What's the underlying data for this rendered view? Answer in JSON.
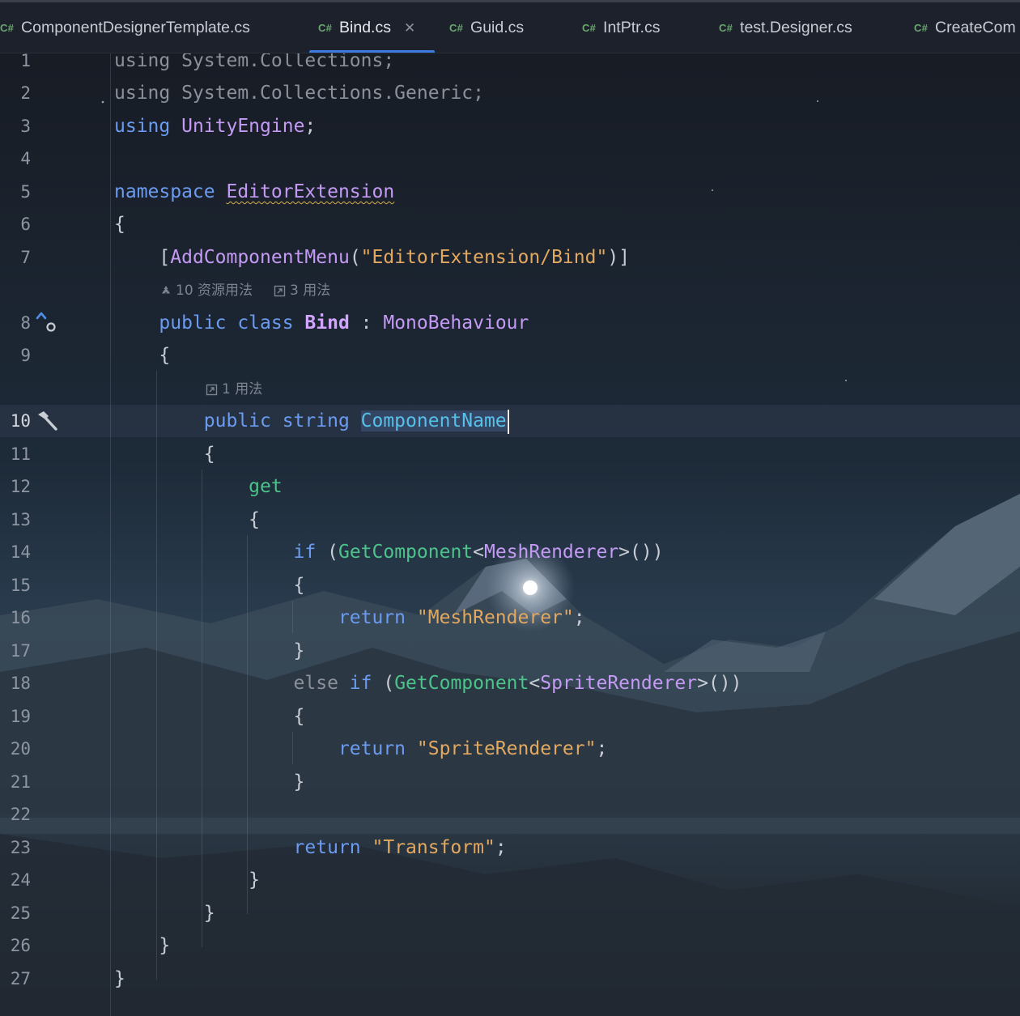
{
  "tabs": [
    {
      "lang": "C#",
      "label": "ComponentDesignerTemplate.cs"
    },
    {
      "lang": "C#",
      "label": "Bind.cs",
      "active": true
    },
    {
      "lang": "C#",
      "label": "Guid.cs"
    },
    {
      "lang": "C#",
      "label": "IntPtr.cs"
    },
    {
      "lang": "C#",
      "label": "test.Designer.cs"
    },
    {
      "lang": "C#",
      "label": "CreateCom"
    }
  ],
  "editor": {
    "hints": {
      "class_resource_usages": "10 资源用法",
      "class_usages": "3 用法",
      "property_usages": "1 用法"
    },
    "lines": [
      {
        "n": "1",
        "tokens": [
          [
            "dim",
            "using System.Collections;"
          ]
        ]
      },
      {
        "n": "2",
        "tokens": [
          [
            "dim",
            "using System.Collections.Generic;"
          ]
        ]
      },
      {
        "n": "3",
        "tokens": [
          [
            "kw",
            "using "
          ],
          [
            "ty",
            "UnityEngine"
          ],
          [
            "pl",
            ";"
          ]
        ]
      },
      {
        "n": "4",
        "tokens": []
      },
      {
        "n": "5",
        "tokens": [
          [
            "kw",
            "namespace "
          ],
          [
            "ty squig",
            "EditorExtension"
          ]
        ]
      },
      {
        "n": "6",
        "tokens": [
          [
            "pl",
            "{"
          ]
        ]
      },
      {
        "n": "7",
        "tokens": [
          [
            "pl",
            "    ["
          ],
          [
            "ty",
            "AddComponentMenu"
          ],
          [
            "pl",
            "("
          ],
          [
            "str",
            "\"EditorExtension/Bind\""
          ],
          [
            "pl",
            ")]"
          ]
        ]
      },
      {
        "n": "8",
        "tokens": [
          [
            "kw",
            "    public class "
          ],
          [
            "bold",
            "Bind"
          ],
          [
            "pl",
            " : "
          ],
          [
            "ty",
            "MonoBehaviour"
          ]
        ]
      },
      {
        "n": "9",
        "tokens": [
          [
            "pl",
            "    {"
          ]
        ]
      },
      {
        "n": "10",
        "tokens": [
          [
            "kw",
            "        public string "
          ],
          [
            "id sel",
            "ComponentName"
          ]
        ]
      },
      {
        "n": "11",
        "tokens": [
          [
            "pl",
            "        {"
          ]
        ]
      },
      {
        "n": "12",
        "tokens": [
          [
            "fn",
            "            get"
          ]
        ]
      },
      {
        "n": "13",
        "tokens": [
          [
            "pl",
            "            {"
          ]
        ]
      },
      {
        "n": "14",
        "tokens": [
          [
            "kw",
            "                if "
          ],
          [
            "pl",
            "("
          ],
          [
            "fn",
            "GetComponent"
          ],
          [
            "pl",
            "<"
          ],
          [
            "ty",
            "MeshRenderer"
          ],
          [
            "pl",
            ">())"
          ]
        ]
      },
      {
        "n": "15",
        "tokens": [
          [
            "pl",
            "                {"
          ]
        ]
      },
      {
        "n": "16",
        "tokens": [
          [
            "kw",
            "                    return "
          ],
          [
            "str",
            "\"MeshRenderer\""
          ],
          [
            "pl",
            ";"
          ]
        ]
      },
      {
        "n": "17",
        "tokens": [
          [
            "pl",
            "                }"
          ]
        ]
      },
      {
        "n": "18",
        "tokens": [
          [
            "dim",
            "                else "
          ],
          [
            "kw",
            "if "
          ],
          [
            "pl",
            "("
          ],
          [
            "fn",
            "GetComponent"
          ],
          [
            "pl",
            "<"
          ],
          [
            "ty",
            "SpriteRenderer"
          ],
          [
            "pl",
            ">())"
          ]
        ]
      },
      {
        "n": "19",
        "tokens": [
          [
            "pl",
            "                {"
          ]
        ]
      },
      {
        "n": "20",
        "tokens": [
          [
            "kw",
            "                    return "
          ],
          [
            "str",
            "\"SpriteRenderer\""
          ],
          [
            "pl",
            ";"
          ]
        ]
      },
      {
        "n": "21",
        "tokens": [
          [
            "pl",
            "                }"
          ]
        ]
      },
      {
        "n": "22",
        "tokens": []
      },
      {
        "n": "23",
        "tokens": [
          [
            "kw",
            "                return "
          ],
          [
            "str",
            "\"Transform\""
          ],
          [
            "pl",
            ";"
          ]
        ]
      },
      {
        "n": "24",
        "tokens": [
          [
            "pl",
            "            }"
          ]
        ]
      },
      {
        "n": "25",
        "tokens": [
          [
            "pl",
            "        }"
          ]
        ]
      },
      {
        "n": "26",
        "tokens": [
          [
            "pl",
            "    }"
          ]
        ]
      },
      {
        "n": "27",
        "tokens": [
          [
            "pl",
            "}"
          ]
        ]
      }
    ]
  }
}
